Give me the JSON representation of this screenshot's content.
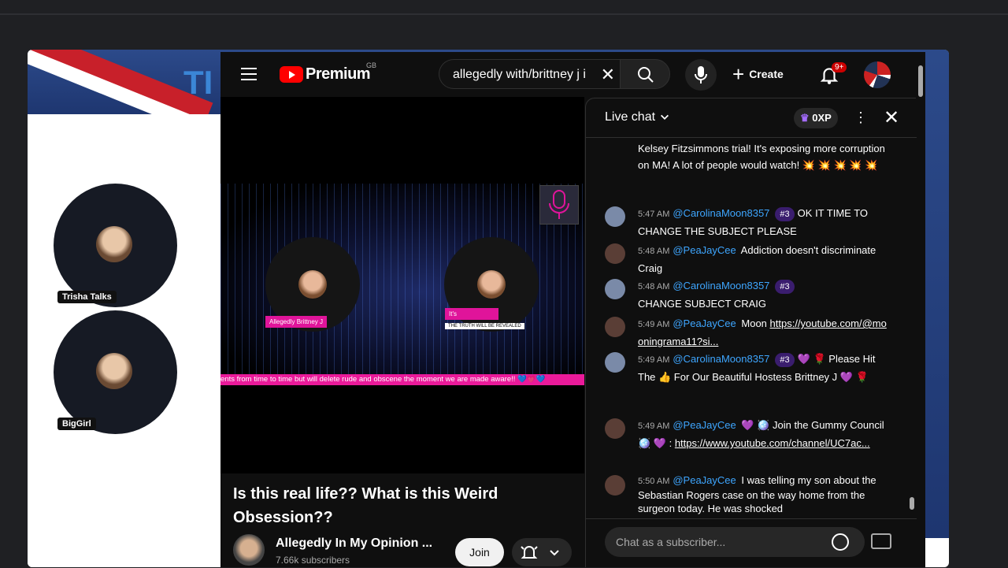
{
  "background": {
    "banner_text": "TI",
    "participants": [
      {
        "label": "Trisha Talks"
      },
      {
        "label": "BigGirl"
      }
    ]
  },
  "header": {
    "logo_word": "Premium",
    "region": "GB",
    "search_query": "allegedly with/brittney j i",
    "create_label": "Create",
    "notification_badge": "9+"
  },
  "video": {
    "speaker_left": "Allegedly Brittney J",
    "speaker_right_top": "It's",
    "speaker_right_sub": "THE TRUTH WILL BE REVEALED",
    "ticker": "ents from time to time but will delete rude and obscene the moment we are made aware!! 💙💗💙",
    "title": "Is this real life?? What is this Weird Obsession??",
    "channel_name": "Allegedly In My Opinion ...",
    "subscribers": "7.66k subscribers",
    "join_label": "Join"
  },
  "chat": {
    "title": "Live chat",
    "xp": "0XP",
    "input_placeholder": "Chat as a subscriber...",
    "messages": [
      {
        "text": "Kelsey Fitzsimmons trial! It's exposing more corruption on MA! A lot of people would watch! 💥 💥 💥 💥 💥"
      },
      {
        "time": "5:47 AM",
        "author": "@CarolinaMoon8357",
        "rank": "#3",
        "text": "OK IT TIME TO CHANGE THE SUBJECT PLEASE"
      },
      {
        "time": "5:48 AM",
        "author": "@PeaJayCee",
        "text": "Addiction doesn't discriminate Craig"
      },
      {
        "time": "5:48 AM",
        "author": "@CarolinaMoon8357",
        "rank": "#3",
        "text": "CHANGE SUBJECT CRAIG"
      },
      {
        "time": "5:49 AM",
        "author": "@PeaJayCee",
        "text": "Moon ",
        "link": "https://youtube.com/@mooningrama11?si..."
      },
      {
        "time": "5:49 AM",
        "author": "@CarolinaMoon8357",
        "rank": "#3",
        "text": "💜 🌹 Please Hit The 👍 For Our Beautiful Hostess Brittney J 💜 🌹"
      },
      {
        "time": "5:49 AM",
        "author": "@PeaJayCee",
        "text": "💜 🪩 Join the Gummy Council 🪩 💜 : ",
        "link": "https://www.youtube.com/channel/UC7ac..."
      },
      {
        "time": "5:50 AM",
        "author": "@PeaJayCee",
        "text": "I was telling my son about the Sebastian Rogers case on the way home from the surgeon today. He was shocked"
      }
    ]
  }
}
